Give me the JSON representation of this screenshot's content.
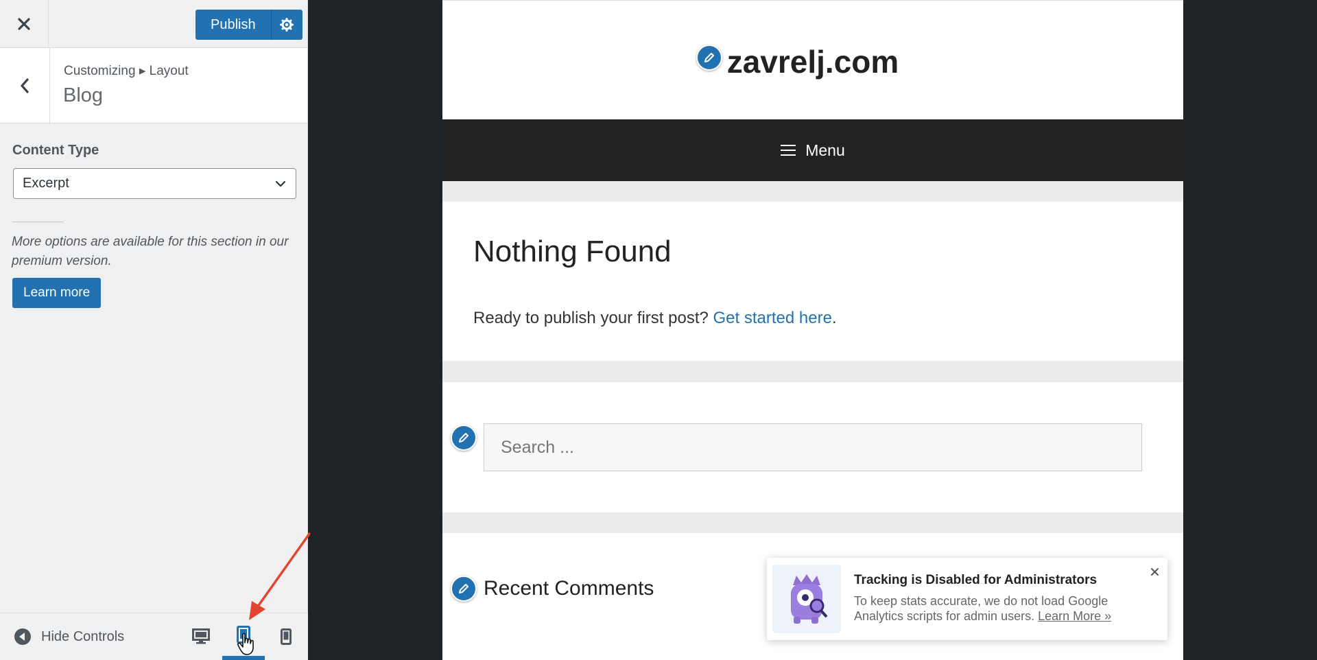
{
  "customizer": {
    "publish_label": "Publish",
    "breadcrumb": "Customizing ▸ Layout",
    "section_title": "Blog",
    "content_type": {
      "label": "Content Type",
      "selected": "Excerpt"
    },
    "premium_note": "More options are available for this section in our premium version.",
    "learn_more_label": "Learn more",
    "footer": {
      "hide_controls_label": "Hide Controls",
      "active_device": "tablet"
    },
    "accent_color": "#2271b1"
  },
  "preview": {
    "site_title": "zavrelj.com",
    "menu_label": "Menu",
    "nothing_found": {
      "title": "Nothing Found",
      "text_prefix": "Ready to publish your first post? ",
      "link_text": "Get started here",
      "text_suffix": "."
    },
    "search_placeholder": "Search ...",
    "recent_comments_title": "Recent Comments",
    "notice": {
      "title": "Tracking is Disabled for Administrators",
      "text": "To keep stats accurate, we do not load Google Analytics scripts for admin users. ",
      "link": "Learn More »"
    }
  }
}
